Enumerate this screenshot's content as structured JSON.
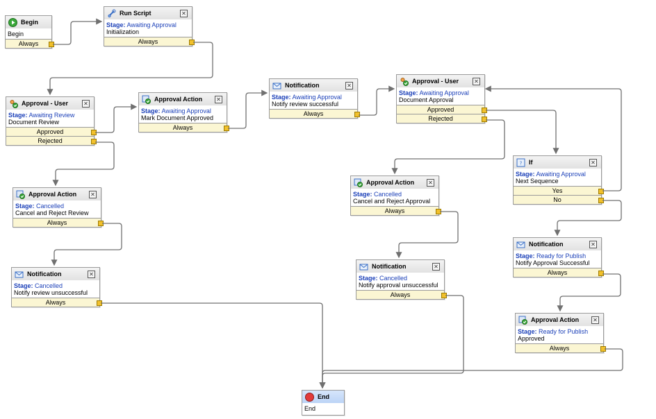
{
  "stage_label": "Stage:",
  "nodes": {
    "begin": {
      "title": "Begin",
      "desc": "Begin",
      "outputs": [
        "Always"
      ]
    },
    "run_script": {
      "title": "Run Script",
      "stage": "Awaiting Approval",
      "desc": "Initialization",
      "outputs": [
        "Always"
      ]
    },
    "approval_user_1": {
      "title": "Approval - User",
      "stage": "Awaiting Review",
      "desc": "Document Review",
      "outputs": [
        "Approved",
        "Rejected"
      ]
    },
    "approval_action_1": {
      "title": "Approval Action",
      "stage": "Awaiting Approval",
      "desc": "Mark Document Approved",
      "outputs": [
        "Always"
      ]
    },
    "notification_1": {
      "title": "Notification",
      "stage": "Awaiting Approval",
      "desc": "Notify review successful",
      "outputs": [
        "Always"
      ]
    },
    "approval_user_2": {
      "title": "Approval - User",
      "stage": "Awaiting Approval",
      "desc": "Document Approval",
      "outputs": [
        "Approved",
        "Rejected"
      ]
    },
    "approval_action_2": {
      "title": "Approval Action",
      "stage": "Cancelled",
      "desc": "Cancel and Reject Review",
      "outputs": [
        "Always"
      ]
    },
    "notification_2": {
      "title": "Notification",
      "stage": "Cancelled",
      "desc": "Notify review unsuccessful",
      "outputs": [
        "Always"
      ]
    },
    "approval_action_3": {
      "title": "Approval Action",
      "stage": "Cancelled",
      "desc": "Cancel and Reject Approval",
      "outputs": [
        "Always"
      ]
    },
    "notification_3": {
      "title": "Notification",
      "stage": "Cancelled",
      "desc": "Notify approval unsuccessful",
      "outputs": [
        "Always"
      ]
    },
    "if_node": {
      "title": "If",
      "stage": "Awaiting Approval",
      "desc": "Next Sequence",
      "outputs": [
        "Yes",
        "No"
      ]
    },
    "notification_4": {
      "title": "Notification",
      "stage": "Ready for Publish",
      "desc": "Notify Approval Successful",
      "outputs": [
        "Always"
      ]
    },
    "approval_action_4": {
      "title": "Approval Action",
      "stage": "Ready for Publish",
      "desc": "Approved",
      "outputs": [
        "Always"
      ]
    },
    "end": {
      "title": "End",
      "desc": "End"
    }
  },
  "colors": {
    "stage_text": "#1a3fb8",
    "output_bg": "#fbf6d3",
    "port": "#f2c12c",
    "wire": "#707070"
  }
}
